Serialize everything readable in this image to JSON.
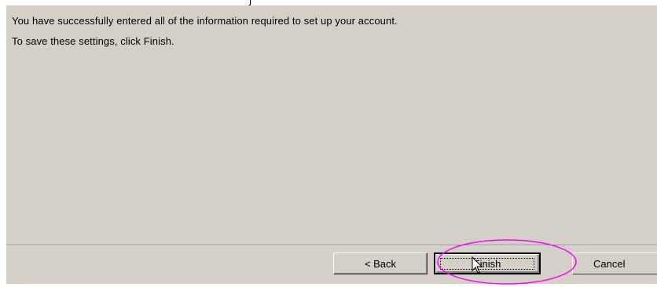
{
  "top_fragment": "j",
  "wizard": {
    "message_line1": "You have successfully entered all of the information required to set up your account.",
    "message_line2": "To save these settings, click Finish."
  },
  "buttons": {
    "back_label": "< Back",
    "finish_label": "Finish",
    "cancel_label": "Cancel"
  },
  "annotation": {
    "highlight_color": "#ff00ff"
  },
  "cursor": {
    "icon": "arrow-pointer-icon"
  }
}
